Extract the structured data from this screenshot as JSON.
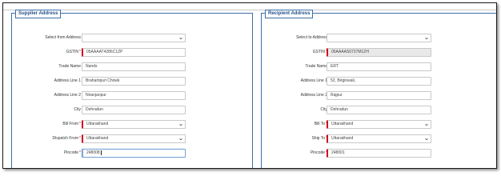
{
  "supplier": {
    "legend": "Supplier Address",
    "select_label": "Select from Address",
    "select_value": "",
    "gstin_label": "GSTIN",
    "gstin_value": "05AAAAT4286C1ZP",
    "trade_name_label": "Trade Name",
    "trade_name_value": "Nands",
    "address1_label": "Address Line 1",
    "address1_value": "Brahampuri Chowk",
    "address2_label": "Address Line 2",
    "address2_value": "Niranjanpur",
    "city_label": "City",
    "city_value": "Dehradun",
    "bill_from_label": "Bill From",
    "bill_from_value": "Uttarakhand",
    "dispatch_from_label": "Dispatch From",
    "dispatch_from_value": "Uttarakhand",
    "pincode_label": "Pincode",
    "pincode_value": "248008"
  },
  "recipient": {
    "legend": "Recipient Address",
    "select_label": "Select to Address",
    "select_value": "",
    "gstin_label": "GSTIN",
    "gstin_value": "05AAAAS0737M1ZH",
    "trade_name_label": "Trade Name",
    "trade_name_value": "ERT",
    "address1_label": "Address Line 1",
    "address1_value": "52, Birginwali,",
    "address2_label": "Address Line 2",
    "address2_value": "Rajpur",
    "city_label": "City",
    "city_value": "Dehradun",
    "bill_to_label": "Bill To",
    "bill_to_value": "Uttarakhand",
    "ship_to_label": "Ship To",
    "ship_to_value": "Uttarakhand",
    "pincode_label": "Pincode",
    "pincode_value": "248001"
  },
  "required_marker": "*",
  "colors": {
    "accent": "#3d6fa8",
    "legend_text": "#1f4e8a",
    "required": "#d0021b"
  },
  "icons": {
    "dropdown": "chevron-down-icon"
  }
}
